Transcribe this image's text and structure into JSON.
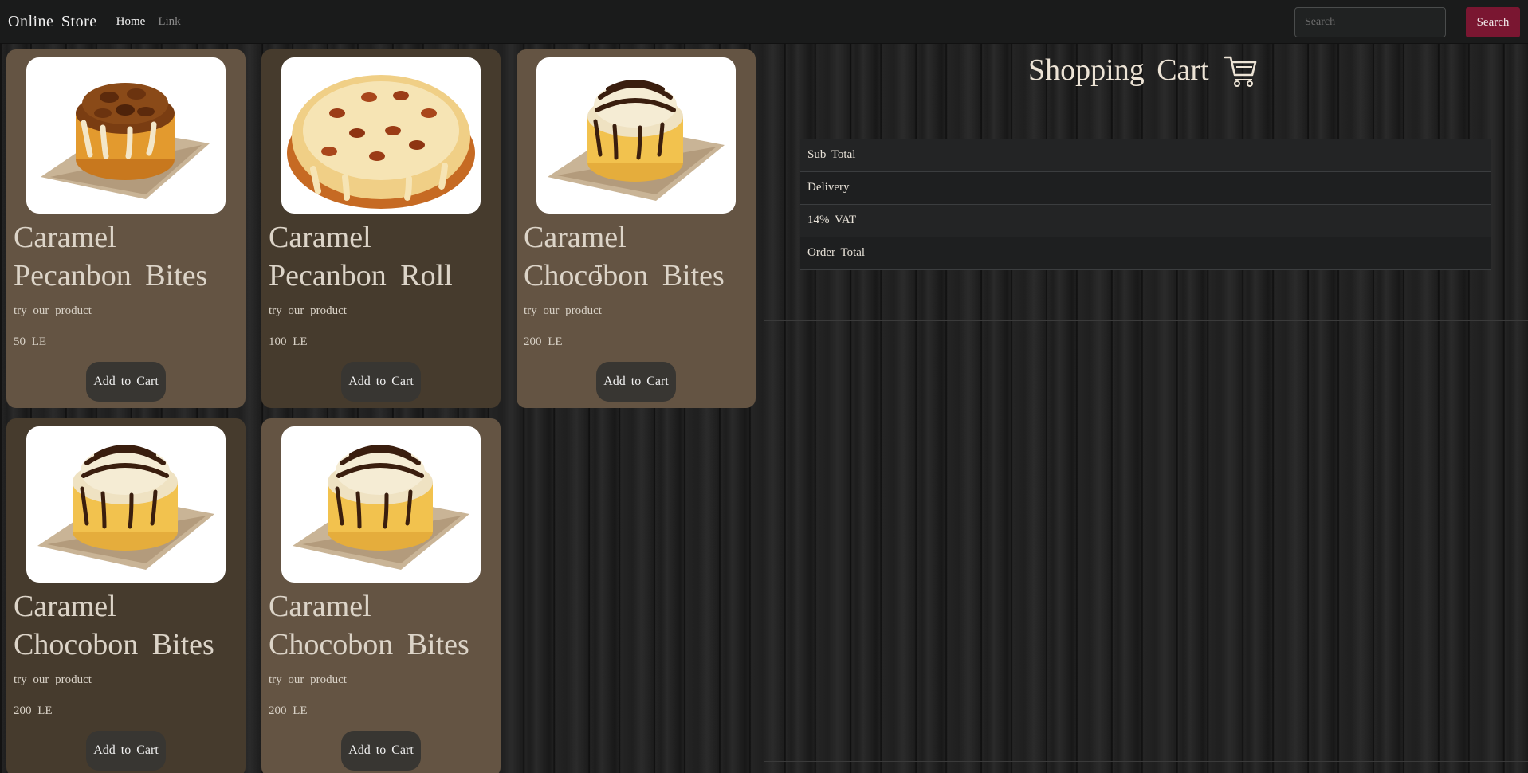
{
  "navbar": {
    "brand": "Online Store",
    "links": [
      "Home",
      "Link"
    ],
    "search_placeholder": "Search",
    "search_button": "Search"
  },
  "products": [
    {
      "title": "Caramel Pecanbon Bites",
      "text": "try our product",
      "price": "50 LE",
      "button": "Add to Cart",
      "image": "pecan-cinnamon-roll"
    },
    {
      "title": "Caramel Pecanbon Roll",
      "text": "try our product",
      "price": "100 LE",
      "button": "Add to Cart",
      "image": "pecan-cinnamon-roll-glazed"
    },
    {
      "title": "Caramel Chocobon Bites",
      "text": "try our product",
      "price": "200 LE",
      "button": "Add to Cart",
      "image": "chocolate-cinnamon-roll"
    },
    {
      "title": "Caramel Chocobon Bites",
      "text": "try our product",
      "price": "200 LE",
      "button": "Add to Cart",
      "image": "chocolate-cinnamon-roll"
    },
    {
      "title": "Caramel Chocobon Bites",
      "text": "try our product",
      "price": "200 LE",
      "button": "Add to Cart",
      "image": "chocolate-cinnamon-roll"
    }
  ],
  "cart": {
    "title": "Shopping Cart",
    "icon": "cart-icon",
    "rows": [
      "Sub Total",
      "Delivery",
      "14% VAT",
      "Order Total"
    ]
  },
  "colors": {
    "navbar": "#1a1b1b",
    "search_button": "#7a1631",
    "card_light": "#645443",
    "card_dark": "#463b2d"
  }
}
